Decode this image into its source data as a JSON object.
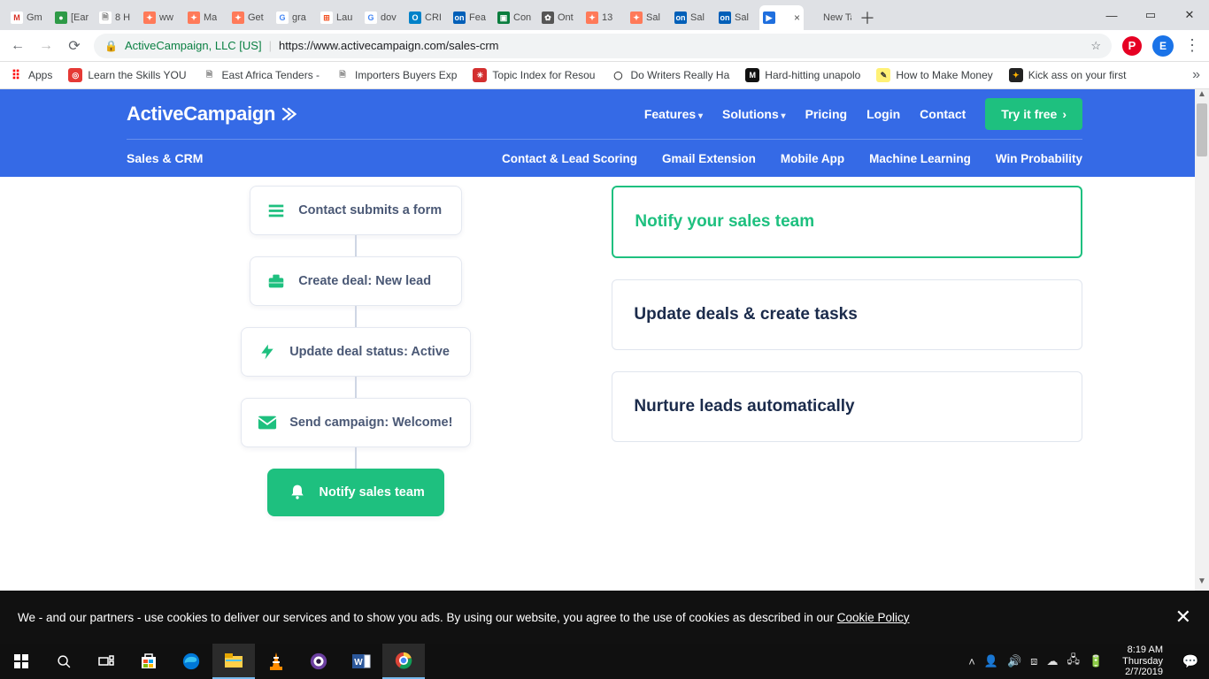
{
  "browser": {
    "tabs": [
      {
        "label": "Gm",
        "favicon_bg": "#ffffff",
        "favicon_fg": "#d93025",
        "favicon_text": "M"
      },
      {
        "label": "[Ear",
        "favicon_bg": "#2e9a47",
        "favicon_fg": "#fff",
        "favicon_text": "●"
      },
      {
        "label": "8 H",
        "favicon_bg": "#ffffff",
        "favicon_fg": "#777",
        "favicon_text": "🗎"
      },
      {
        "label": "ww",
        "favicon_bg": "#ff7a59",
        "favicon_fg": "#fff",
        "favicon_text": "✦"
      },
      {
        "label": "Ma",
        "favicon_bg": "#ff7a59",
        "favicon_fg": "#fff",
        "favicon_text": "✦"
      },
      {
        "label": "Get",
        "favicon_bg": "#ff7a59",
        "favicon_fg": "#fff",
        "favicon_text": "✦"
      },
      {
        "label": "gra",
        "favicon_bg": "#fff",
        "favicon_fg": "#4285f4",
        "favicon_text": "G"
      },
      {
        "label": "Lau",
        "favicon_bg": "#fff",
        "favicon_fg": "#f25022",
        "favicon_text": "⊞"
      },
      {
        "label": "dov",
        "favicon_bg": "#fff",
        "favicon_fg": "#4285f4",
        "favicon_text": "G"
      },
      {
        "label": "CRI",
        "favicon_bg": "#0082c9",
        "favicon_fg": "#fff",
        "favicon_text": "O"
      },
      {
        "label": "Fea",
        "favicon_bg": "#005fb8",
        "favicon_fg": "#fff",
        "favicon_text": "on"
      },
      {
        "label": "Con",
        "favicon_bg": "#0a7d3e",
        "favicon_fg": "#fff",
        "favicon_text": "▣"
      },
      {
        "label": "Ont",
        "favicon_bg": "#555",
        "favicon_fg": "#fff",
        "favicon_text": "✿"
      },
      {
        "label": "13",
        "favicon_bg": "#ff7a59",
        "favicon_fg": "#fff",
        "favicon_text": "✦"
      },
      {
        "label": "Sal",
        "favicon_bg": "#ff7a59",
        "favicon_fg": "#fff",
        "favicon_text": "✦"
      },
      {
        "label": "Sal",
        "favicon_bg": "#005fb8",
        "favicon_fg": "#fff",
        "favicon_text": "on"
      },
      {
        "label": "Sal",
        "favicon_bg": "#005fb8",
        "favicon_fg": "#fff",
        "favicon_text": "on"
      },
      {
        "label": "",
        "favicon_bg": "#1f6fde",
        "favicon_fg": "#fff",
        "favicon_text": "▶",
        "active": true,
        "closeable": true
      },
      {
        "label": "New Ta",
        "favicon_bg": "transparent",
        "favicon_fg": "#888",
        "favicon_text": ""
      }
    ],
    "address": {
      "origin_label": "ActiveCampaign, LLC [US]",
      "url": "https://www.activecampaign.com/sales-crm"
    },
    "avatar_initial": "E",
    "bookmarks_label_apps": "Apps",
    "bookmarks": [
      {
        "label": "Learn the Skills YOU",
        "ico_bg": "#e53935",
        "ico_fg": "#fff",
        "ico_text": "◎"
      },
      {
        "label": "East Africa Tenders -",
        "ico_bg": "#fff",
        "ico_fg": "#777",
        "ico_text": "🗎"
      },
      {
        "label": "Importers Buyers Exp",
        "ico_bg": "#fff",
        "ico_fg": "#777",
        "ico_text": "🗎"
      },
      {
        "label": "Topic Index for Resou",
        "ico_bg": "#d32f2f",
        "ico_fg": "#fff",
        "ico_text": "✳"
      },
      {
        "label": "Do Writers Really Ha",
        "ico_bg": "#fff",
        "ico_fg": "#333",
        "ico_text": "◯"
      },
      {
        "label": "Hard-hitting unapolo",
        "ico_bg": "#111",
        "ico_fg": "#fff",
        "ico_text": "M"
      },
      {
        "label": "How to Make Money",
        "ico_bg": "#fff176",
        "ico_fg": "#333",
        "ico_text": "✎"
      },
      {
        "label": "Kick ass on your first",
        "ico_bg": "#222",
        "ico_fg": "#ffb300",
        "ico_text": "✦"
      }
    ]
  },
  "site": {
    "logo_text": "ActiveCampaign",
    "nav": {
      "features": "Features",
      "solutions": "Solutions",
      "pricing": "Pricing",
      "login": "Login",
      "contact": "Contact",
      "cta": "Try it free"
    },
    "breadcrumb": "Sales & CRM",
    "subnav": {
      "scoring": "Contact & Lead Scoring",
      "gmail": "Gmail Extension",
      "mobile": "Mobile App",
      "ml": "Machine Learning",
      "win": "Win Probability"
    },
    "flow": {
      "step1": "Contact submits a form",
      "step2": "Create deal: New lead",
      "step3": "Update deal status: Active",
      "step4": "Send campaign: Welcome!",
      "final": "Notify sales team"
    },
    "cards": {
      "c1": "Notify your sales team",
      "c2": "Update deals & create tasks",
      "c3": "Nurture leads automatically"
    }
  },
  "cookie": {
    "text_prefix": "We - and our partners - use cookies to deliver our services and to show you ads. By using our website, you agree to the use of cookies as described in our ",
    "link": "Cookie Policy"
  },
  "taskbar": {
    "time": "8:19 AM",
    "day": "Thursday",
    "date": "2/7/2019"
  }
}
